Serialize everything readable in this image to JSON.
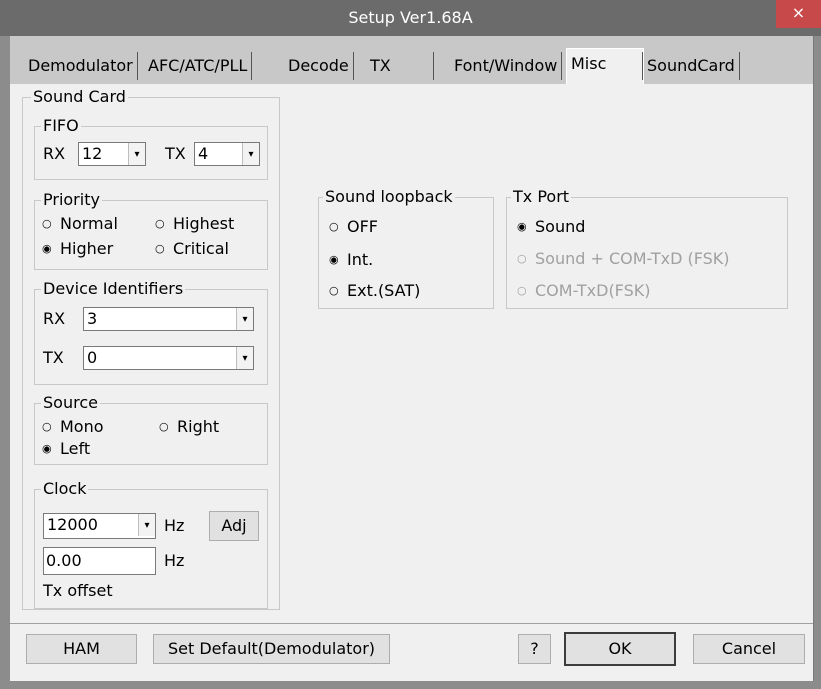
{
  "window": {
    "title": "Setup Ver1.68A",
    "close_glyph": "×"
  },
  "tabs": [
    "Demodulator",
    "AFC/ATC/PLL",
    "Decode",
    "TX",
    "Font/Window",
    "Misc",
    "SoundCard"
  ],
  "active_tab": "Misc",
  "sound_card": {
    "label": "Sound Card",
    "fifo": {
      "label": "FIFO",
      "rx_label": "RX",
      "rx_value": "12",
      "tx_label": "TX",
      "tx_value": "4"
    },
    "priority": {
      "label": "Priority",
      "options": [
        "Normal",
        "Highest",
        "Higher",
        "Critical"
      ],
      "selected": "Higher"
    },
    "device_identifiers": {
      "label": "Device Identifiers",
      "rx_label": "RX",
      "rx_value": "3",
      "tx_label": "TX",
      "tx_value": "0"
    },
    "source": {
      "label": "Source",
      "options": [
        "Mono",
        "Right",
        "Left"
      ],
      "selected": "Left"
    },
    "clock": {
      "label": "Clock",
      "value": "12000",
      "unit": "Hz",
      "adj_label": "Adj",
      "offset_value": "0.00",
      "offset_unit": "Hz",
      "offset_label": "Tx offset"
    }
  },
  "sound_loopback": {
    "label": "Sound loopback",
    "options": [
      "OFF",
      "Int.",
      "Ext.(SAT)"
    ],
    "selected": "Int."
  },
  "tx_port": {
    "label": "Tx Port",
    "options": [
      "Sound",
      "Sound + COM-TxD (FSK)",
      "COM-TxD(FSK)"
    ],
    "selected": "Sound"
  },
  "buttons": {
    "ham": "HAM",
    "set_default": "Set Default(Demodulator)",
    "help": "?",
    "ok": "OK",
    "cancel": "Cancel"
  },
  "glyphs": {
    "radio_on": "◉",
    "radio_off": "○",
    "dropdown": "▾"
  }
}
